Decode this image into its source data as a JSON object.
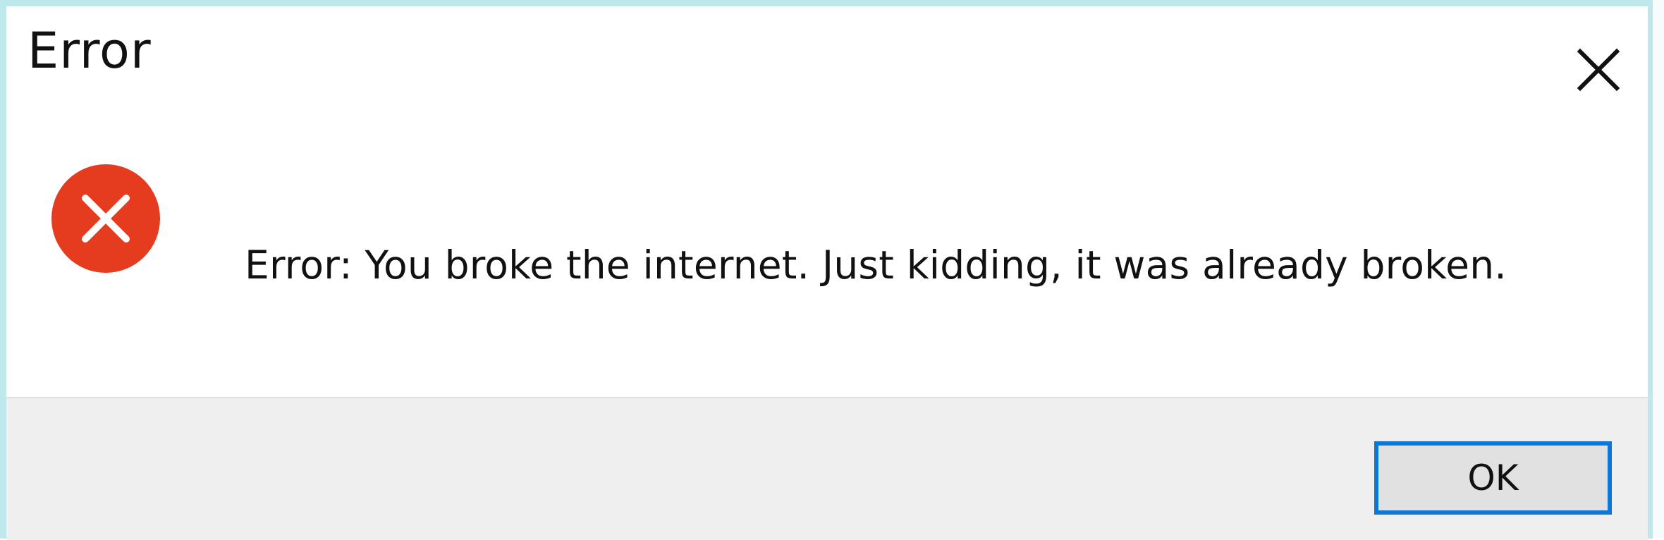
{
  "window": {
    "title": "Error"
  },
  "icons": {
    "close": "close-icon",
    "error": "error-icon"
  },
  "content": {
    "message": "Error: You broke the internet. Just kidding, it was already broken."
  },
  "buttons": {
    "ok_label": "OK"
  },
  "colors": {
    "accent": "#0b78d7",
    "error": "#e53b1f",
    "footer_background": "#efefef"
  }
}
